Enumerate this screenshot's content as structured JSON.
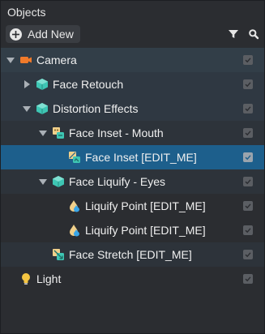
{
  "panel": {
    "title": "Objects",
    "add_new_label": "Add New",
    "filter_icon": "filter-icon",
    "search_icon": "search-icon"
  },
  "tree": [
    {
      "label": "Camera",
      "icon": "camera-icon",
      "expanded": true,
      "visible": true
    },
    {
      "label": "Face Retouch",
      "icon": "face-cube-icon",
      "expanded": false,
      "visible": true
    },
    {
      "label": "Distortion Effects",
      "icon": "face-cube-icon",
      "expanded": true,
      "visible": true
    },
    {
      "label": "Face Inset - Mouth",
      "icon": "face-inset-icon",
      "expanded": true,
      "visible": true
    },
    {
      "label": "Face Inset [EDIT_ME]",
      "icon": "face-inset-icon",
      "selected": true,
      "visible": true
    },
    {
      "label": "Face Liquify - Eyes",
      "icon": "face-cube-icon",
      "expanded": true,
      "visible": true
    },
    {
      "label": "Liquify Point [EDIT_ME]",
      "icon": "liquify-drop-icon",
      "visible": true
    },
    {
      "label": "Liquify Point [EDIT_ME]",
      "icon": "liquify-drop-icon",
      "visible": true
    },
    {
      "label": "Face Stretch [EDIT_ME]",
      "icon": "face-stretch-icon",
      "visible": true
    },
    {
      "label": "Light",
      "icon": "light-bulb-icon",
      "visible": true
    }
  ],
  "colors": {
    "accent_selected": "#1d5f8c",
    "camera_orange": "#f07a2a",
    "teal": "#3ec6b4",
    "bulb_yellow": "#f5c542"
  }
}
